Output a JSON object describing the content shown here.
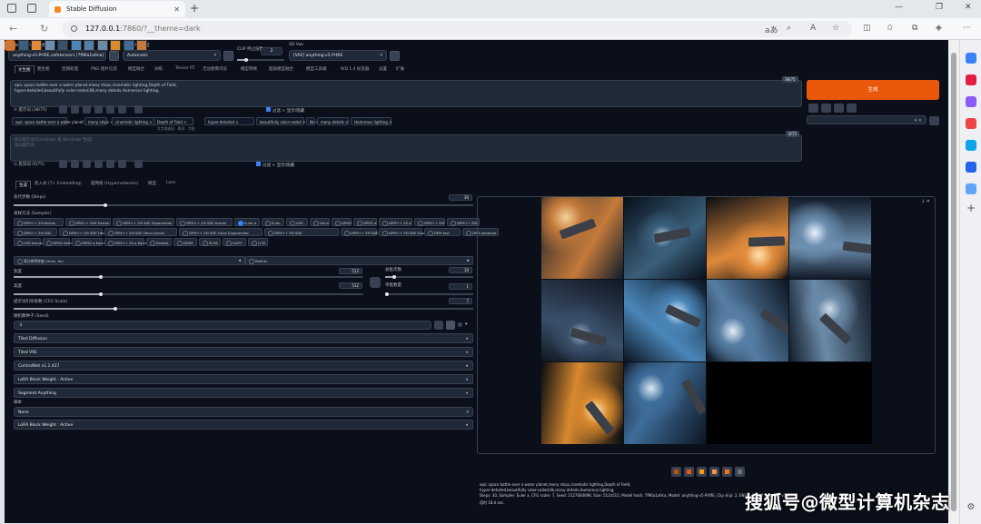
{
  "browser": {
    "tab_title": "Stable Diffusion",
    "url_host": "127.0.0.1",
    "url_rest": ":7860/?__theme=dark"
  },
  "top": {
    "model_label": "Stable Diffusion 模型",
    "model_value": "anything-v5-PrtRE.safetensors [7f96a1a9ca]",
    "vae_label": "外挂 VAE 模型",
    "vae_value": "Automatic",
    "clip_label": "CLIP 终止层数",
    "clip_value": "2",
    "sd_vae_label": "SD Vae",
    "sd_vae_value": "[VAE] anything-v5-PrtRE"
  },
  "tabs": [
    "文生图",
    "图生图",
    "后期处理",
    "PNG 图片信息",
    "模型融合",
    "训练",
    "Tensor RT",
    "无边图像浏览",
    "模型转换",
    "超级模型融合",
    "模型工具箱",
    "WD 1.4 标签器",
    "设置",
    "扩展"
  ],
  "prompt": {
    "text": "epic space battle over a water planet,many ships,cinematic lighting,Depth of Field,\nhyper-detailed,beautifully color-coded,8k,many details,Humorous lighting,",
    "counter": "38/75",
    "toolbar_label": "提示词",
    "toolbar_count": "(38/75)",
    "checkbox_label": "过滤 > 显示/隐藏",
    "chips": [
      "epic space battle over a water planet",
      "many ships",
      "cinematic lighting",
      "Depth of Field",
      "hyper-detailed",
      "beautifully color-coded",
      "8k",
      "many details",
      "Humorous lighting"
    ],
    "chip_sub": "文字描述段 · 景深 · 字段"
  },
  "negative": {
    "placeholder": "反向提示词(Ctrl+Enter 或 Alt+Enter 生成)",
    "placeholder2": "反向提示词",
    "counter": "0/75",
    "toolbar_label": "反向词",
    "toolbar_count": "(0/75)",
    "checkbox_label": "过滤 > 显示/隐藏"
  },
  "generate_label": "生成",
  "subtabs": [
    "生成",
    "嵌入式 (T.I. Embedding)",
    "超网络 (Hypernetworks)",
    "模型",
    "Lora"
  ],
  "params": {
    "steps_label": "迭代步数 (Steps)",
    "steps_value": "30",
    "steps_frac": 0.2,
    "sampler_label": "采样方法 (Sampler)",
    "samplers": [
      "DPM++ 2M Karras",
      "DPM++ SDE Karras",
      "DPM++ 2M SDE Exponential",
      "DPM++ 2M SDE Karras",
      "Euler a",
      "Euler",
      "LMS",
      "Heun",
      "DPM2",
      "DPM2 a",
      "DPM++ 2S a",
      "DPM++ 2M",
      "DPM++ SDE",
      "DPM++ 2M SDE",
      "DPM++ 2M SDE Heun",
      "DPM++ 2M SDE Heun Karras",
      "DPM++ 2M SDE Heun Exponential",
      "DPM++ 3M SDE",
      "DPM++ 3M SDE Karras",
      "DPM++ 3M SDE Exponential",
      "DPM fast",
      "DPM adaptive",
      "LMS Karras",
      "DPM2 Karras",
      "DPM2 a Karras",
      "DPM++ 2S a Karras",
      "Restart",
      "DDIM",
      "PLMS",
      "UniPC",
      "LCM"
    ],
    "selected_sampler": "Euler a",
    "hires_label": "高分辨率修复 (Hires. fix)",
    "refiner_label": "Refiner",
    "width_label": "宽度",
    "width_value": "512",
    "height_label": "高度",
    "height_value": "512",
    "batch_count_label": "总批次数",
    "batch_count_value": "10",
    "batch_size_label": "单批数量",
    "batch_size_value": "1",
    "cfg_label": "提示词引导系数 (CFG Scale)",
    "cfg_value": "7",
    "seed_label": "随机数种子 (Seed)",
    "seed_value": "-1"
  },
  "accordions": [
    "Tiled Diffusion",
    "Tiled VAE",
    "ControlNet v1.1.427",
    "LoRA Block Weight : Active",
    "Segment Anything"
  ],
  "script_label": "脚本",
  "script_value": "None",
  "last_accordion": "LoRA Block Weight : Active",
  "info": {
    "line1": "epic space battle over a water planet,many ships,cinematic lighting,Depth of Field,",
    "line2": "hyper-detailed,beautifully color-coded,8k,many details,Humorous lighting,",
    "line3": "Steps: 30, Sampler: Euler a, CFG scale: 7, Seed: 2127660698, Size: 512x512, Model hash: 7f96a1a9ca, Model: anything-v5-PrtRE, Clip skip: 2, ENSD: 31337, Version: v1.6.0",
    "time": "用时 18.4 sec."
  },
  "watermark": "搜狐号@微型计算机杂志",
  "colors": {
    "accent": "#ea580c",
    "bg": "#0b0f19",
    "panel": "#1f2937"
  }
}
